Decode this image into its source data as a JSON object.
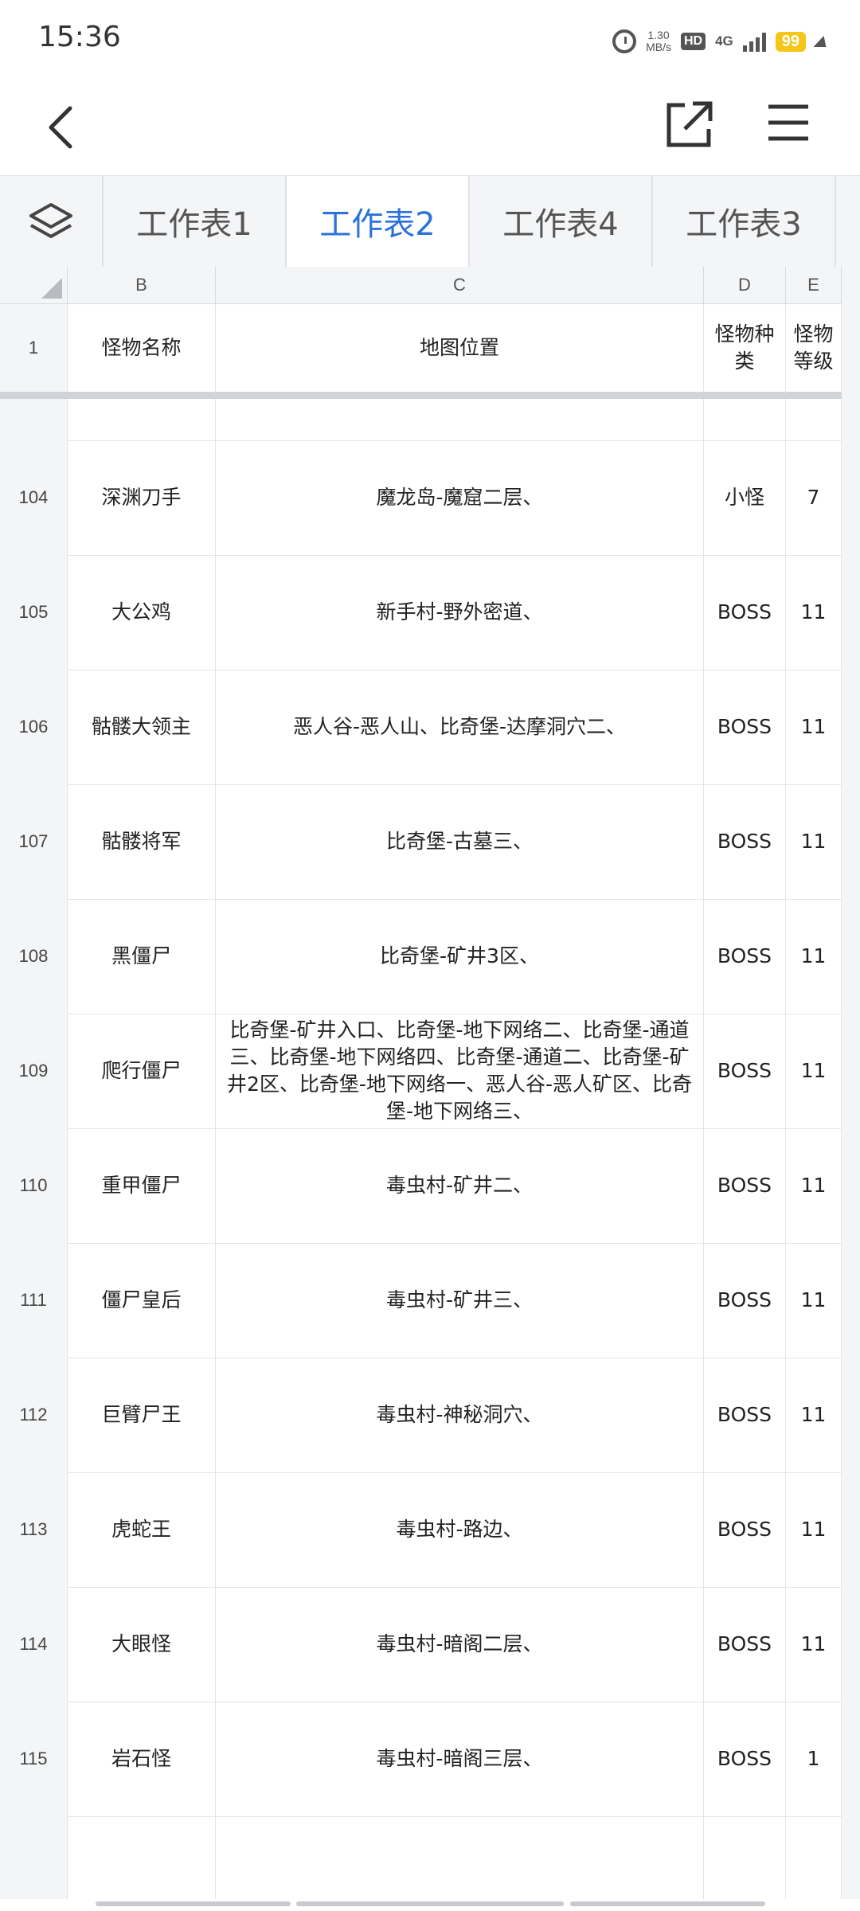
{
  "status": {
    "time": "15:36",
    "speed_top": "1.30",
    "speed_bottom": "MB/s",
    "hd": "HD",
    "network": "4G",
    "battery": "99"
  },
  "tabs": [
    "工作表1",
    "工作表2",
    "工作表4",
    "工作表3"
  ],
  "active_tab": "工作表2",
  "columns": [
    "B",
    "C",
    "D",
    "E"
  ],
  "header_row": {
    "num": "1",
    "b": "怪物名称",
    "c": "地图位置",
    "d": "怪物种类",
    "e": "怪物等级"
  },
  "rows": [
    {
      "num": "104",
      "name": "深渊刀手",
      "location": "魔龙岛-魔窟二层、",
      "type": "小怪",
      "level": "7"
    },
    {
      "num": "105",
      "name": "大公鸡",
      "location": "新手村-野外密道、",
      "type": "BOSS",
      "level": "11"
    },
    {
      "num": "106",
      "name": "骷髅大领主",
      "location": "恶人谷-恶人山、比奇堡-达摩洞穴二、",
      "type": "BOSS",
      "level": "11"
    },
    {
      "num": "107",
      "name": "骷髅将军",
      "location": "比奇堡-古墓三、",
      "type": "BOSS",
      "level": "11"
    },
    {
      "num": "108",
      "name": "黑僵尸",
      "location": "比奇堡-矿井3区、",
      "type": "BOSS",
      "level": "11"
    },
    {
      "num": "109",
      "name": "爬行僵尸",
      "location": "比奇堡-矿井入口、比奇堡-地下网络二、比奇堡-通道三、比奇堡-地下网络四、比奇堡-通道二、比奇堡-矿井2区、比奇堡-地下网络一、恶人谷-恶人矿区、比奇堡-地下网络三、",
      "type": "BOSS",
      "level": "11"
    },
    {
      "num": "110",
      "name": "重甲僵尸",
      "location": "毒虫村-矿井二、",
      "type": "BOSS",
      "level": "11"
    },
    {
      "num": "111",
      "name": "僵尸皇后",
      "location": "毒虫村-矿井三、",
      "type": "BOSS",
      "level": "11"
    },
    {
      "num": "112",
      "name": "巨臂尸王",
      "location": "毒虫村-神秘洞穴、",
      "type": "BOSS",
      "level": "11"
    },
    {
      "num": "113",
      "name": "虎蛇王",
      "location": "毒虫村-路边、",
      "type": "BOSS",
      "level": "11"
    },
    {
      "num": "114",
      "name": "大眼怪",
      "location": "毒虫村-暗阁二层、",
      "type": "BOSS",
      "level": "11"
    },
    {
      "num": "115",
      "name": "岩石怪",
      "location": "毒虫村-暗阁三层、",
      "type": "BOSS",
      "level": "1"
    }
  ]
}
